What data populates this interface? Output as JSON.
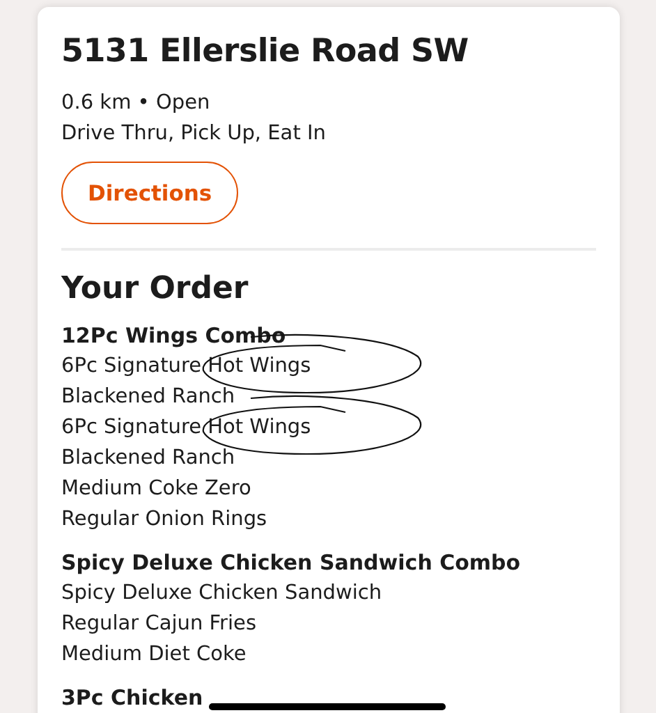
{
  "store": {
    "address": "5131 Ellerslie Road SW",
    "distance_status": "0.6 km • Open",
    "services": "Drive Thru, Pick Up, Eat In",
    "directions_button": "Directions"
  },
  "order": {
    "heading": "Your Order",
    "groups": [
      {
        "name": "12Pc Wings Combo",
        "items": [
          {
            "text": "6Pc Signature Hot Wings",
            "circled": true
          },
          {
            "text": "Blackened Ranch",
            "circled": false
          },
          {
            "text": "6Pc Signature Hot Wings",
            "circled": true
          },
          {
            "text": "Blackened Ranch",
            "circled": false
          },
          {
            "text": "Medium Coke Zero",
            "circled": false
          },
          {
            "text": "Regular Onion Rings",
            "circled": false
          }
        ]
      },
      {
        "name": "Spicy Deluxe Chicken Sandwich Combo",
        "items": [
          {
            "text": "Spicy Deluxe Chicken Sandwich",
            "circled": false
          },
          {
            "text": "Regular Cajun Fries",
            "circled": false
          },
          {
            "text": "Medium Diet Coke",
            "circled": false
          }
        ]
      },
      {
        "name": "3Pc Chicken"
      }
    ]
  }
}
